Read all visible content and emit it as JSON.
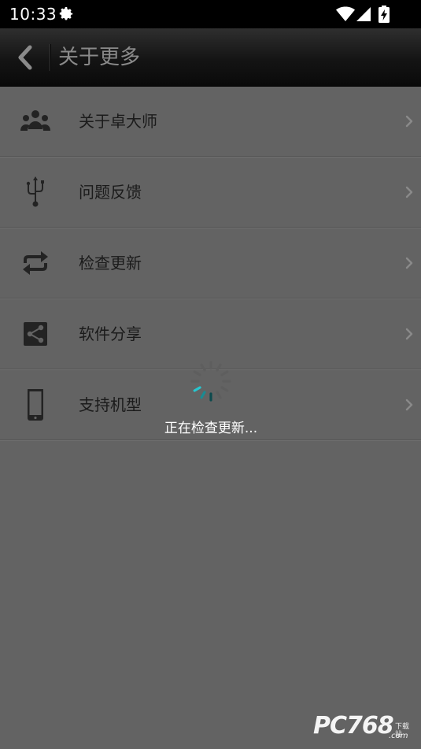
{
  "status_bar": {
    "time": "10:33",
    "icons": [
      "settings-icon",
      "wifi-icon",
      "signal-icon",
      "battery-charging-icon"
    ]
  },
  "header": {
    "title": "关于更多",
    "back_icon": "chevron-left-icon"
  },
  "menu": {
    "items": [
      {
        "label": "关于卓大师",
        "icon": "group-icon"
      },
      {
        "label": "问题反馈",
        "icon": "usb-icon"
      },
      {
        "label": "检查更新",
        "icon": "sync-icon"
      },
      {
        "label": "软件分享",
        "icon": "share-icon"
      },
      {
        "label": "支持机型",
        "icon": "phone-icon"
      }
    ]
  },
  "loading": {
    "text": "正在检查更新..."
  },
  "watermark": {
    "brand": "PC768",
    "tag": "下载站",
    "domain": ".com"
  },
  "colors": {
    "overlay_background": "#636363",
    "spinner_accent": "#27c6cf",
    "header_title": "#8a8a8a"
  }
}
